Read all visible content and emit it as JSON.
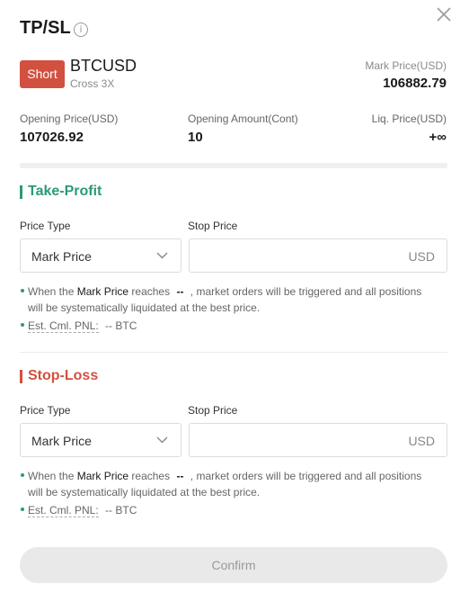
{
  "header": {
    "title": "TP/SL",
    "info_icon": "info-circle-icon",
    "close_icon": "close-icon"
  },
  "position": {
    "side": "Short",
    "side_color": "#d2503f",
    "symbol": "BTCUSD",
    "margin_mode": "Cross 3X",
    "mark_price_label": "Mark Price(USD)",
    "mark_price": "106882.79"
  },
  "stats": {
    "opening_price_label": "Opening Price(USD)",
    "opening_price": "107026.92",
    "opening_amount_label": "Opening Amount(Cont)",
    "opening_amount": "10",
    "liq_price_label": "Liq. Price(USD)",
    "liq_price": "+∞"
  },
  "take_profit": {
    "title": "Take-Profit",
    "accent": "#2c9a7a",
    "price_type_label": "Price Type",
    "price_type_value": "Mark Price",
    "stop_price_label": "Stop Price",
    "stop_price_value": "",
    "unit": "USD",
    "note_prefix": "When the",
    "note_price_name": "Mark Price",
    "note_reaches": "reaches",
    "note_value": "--",
    "note_suffix": ", market orders will be triggered and all positions",
    "note_line2": "will be systematically liquidated at the best price.",
    "pnl_label": "Est. Cml. PNL:",
    "pnl_value": "-- BTC"
  },
  "stop_loss": {
    "title": "Stop-Loss",
    "accent": "#d2503f",
    "price_type_label": "Price Type",
    "price_type_value": "Mark Price",
    "stop_price_label": "Stop Price",
    "stop_price_value": "",
    "unit": "USD",
    "note_prefix": "When the",
    "note_price_name": "Mark Price",
    "note_reaches": "reaches",
    "note_value": "--",
    "note_suffix": ", market orders will be triggered and all positions",
    "note_line2": "will be systematically liquidated at the best price.",
    "pnl_label": "Est. Cml. PNL:",
    "pnl_value": "-- BTC"
  },
  "footer": {
    "confirm_label": "Confirm"
  }
}
